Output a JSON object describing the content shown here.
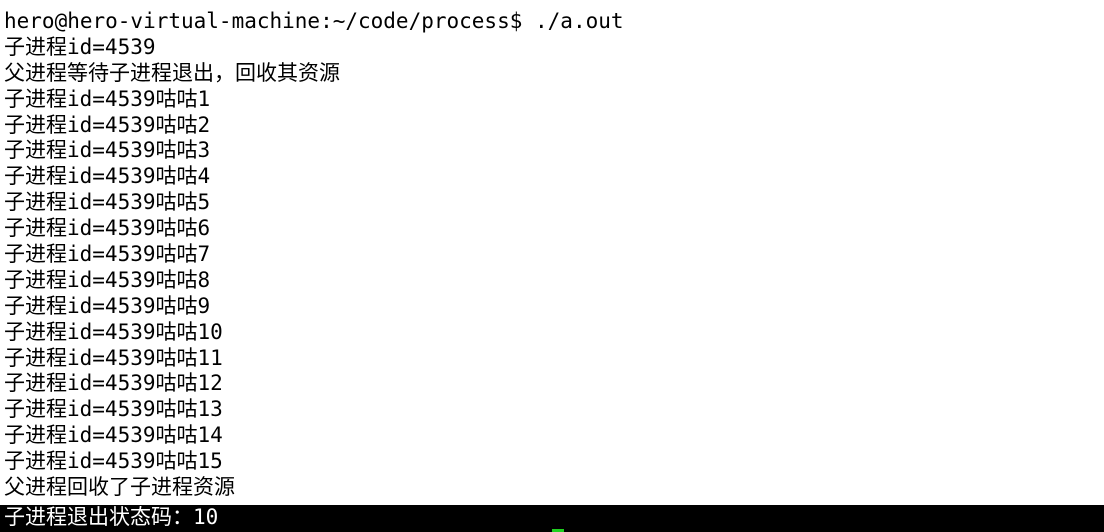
{
  "terminal": {
    "lines": [
      "hero@hero-virtual-machine:~/code/process$ ./a.out",
      "子进程id=4539",
      "父进程等待子进程退出，回收其资源",
      "子进程id=4539咕咕1",
      "子进程id=4539咕咕2",
      "子进程id=4539咕咕3",
      "子进程id=4539咕咕4",
      "子进程id=4539咕咕5",
      "子进程id=4539咕咕6",
      "子进程id=4539咕咕7",
      "子进程id=4539咕咕8",
      "子进程id=4539咕咕9",
      "子进程id=4539咕咕10",
      "子进程id=4539咕咕11",
      "子进程id=4539咕咕12",
      "子进程id=4539咕咕13",
      "子进程id=4539咕咕14",
      "子进程id=4539咕咕15",
      "父进程回收了子进程资源"
    ],
    "last_line": "子进程退出状态码：10",
    "colors": {
      "background": "#ffffff",
      "text": "#000000",
      "highlight_background": "#000000",
      "highlight_text": "#ffffff",
      "cursor": "#1fd01f"
    }
  }
}
